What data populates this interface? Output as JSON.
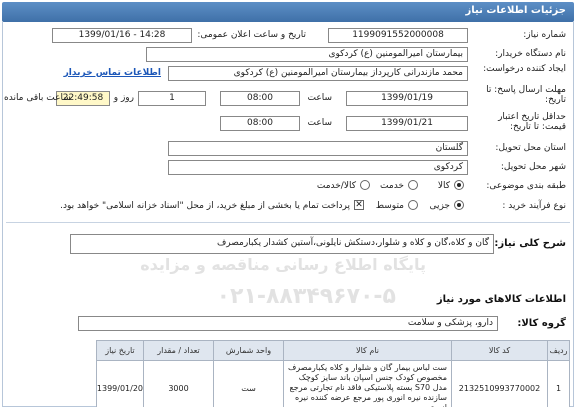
{
  "page_title": "جزئیات اطلاعات نیاز",
  "fields": {
    "need_number_label": "شماره نیاز:",
    "need_number": "1199091552000008",
    "announce_label": "تاریخ و ساعت اعلان عمومی:",
    "announce_value": "1399/01/16 - 14:28",
    "buyer_label": "نام دستگاه خریدار:",
    "buyer_value": "بیمارستان امیرالمومنین (ع) کردکوی",
    "creator_label": "ایجاد کننده درخواست:",
    "creator_value": "محمد مازندرانی کارپرداز بیمارستان امیرالمومنین (ع) کردکوی",
    "contact_link": "اطلاعات تماس خریدار",
    "reply_deadline_label": "مهلت ارسال پاسخ: تا تاریخ:",
    "reply_date": "1399/01/19",
    "time_label": "ساعت",
    "reply_time": "08:00",
    "days_value": "1",
    "days_label": "روز و",
    "remaining_time": "22:49:58",
    "remaining_label": "ساعت باقی مانده",
    "validity_label": "حداقل تاریخ اعتبار قیمت: تا تاریخ:",
    "validity_date": "1399/01/21",
    "validity_time_label": "ساعت",
    "validity_time": "08:00",
    "province_label": "استان محل تحویل:",
    "province_value": "گلستان",
    "city_label": "شهر محل تحویل:",
    "city_value": "کردکوی",
    "category_label": "طبقه بندی موضوعی:",
    "category_options": [
      "کالا",
      "خدمت",
      "کالا/خدمت"
    ],
    "process_label": "نوع فرآیند خرید :",
    "process_options": [
      "جزیی",
      "متوسط"
    ],
    "payment_note": "پرداخت تمام یا بخشی از مبلغ خرید، از محل \"اسناد خزانه اسلامی\" خواهد بود."
  },
  "summary": {
    "label": "شرح کلی نیاز:",
    "value": "گان و کلاه،گان و کلاه و شلوار،دستکش نایلونی،آستین کشدار یکبارمصرف"
  },
  "goods": {
    "section_label": "اطلاعات کالاهای مورد نیاز",
    "group_label": "گروه کالا:",
    "group_value": "دارو، پزشکی و سلامت"
  },
  "watermark": {
    "line1": "پایگاه اطلاع رسانی مناقصه و مزایده",
    "line2": "۰۲۱-۸۸۳۴۹۶۷۰-۵"
  },
  "table": {
    "headers": [
      "ردیف",
      "کد کالا",
      "نام کالا",
      "واحد شمارش",
      "تعداد / مقدار",
      "تاریخ نیاز"
    ],
    "rows": [
      {
        "row": "1",
        "code": "2132510993770002",
        "name": "ست لباس بیمار گان و شلوار و کلاه یکبارمصرف مخصوص کودک جنس اسپان باند سایز کوچک مدل S70 بسته پلاستیکی فاقد نام تجارتی مرجع سازنده نیره انوری پور مرجع عرضه کننده نیره انوری پور",
        "unit": "ست",
        "qty": "3000",
        "date": "1399/01/20"
      }
    ]
  }
}
